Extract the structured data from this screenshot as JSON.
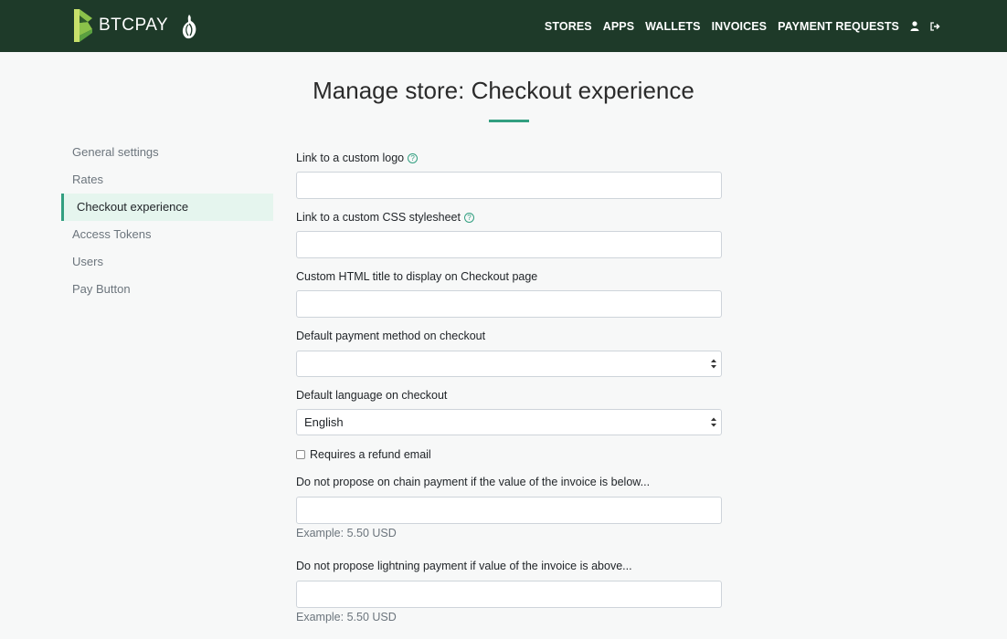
{
  "header": {
    "brand_text": "BTCPAY",
    "brand_colors": {
      "primary": "#8bc24a",
      "dark": "#2f5b2a",
      "bar": "#1e3a29"
    },
    "nav": [
      "STORES",
      "APPS",
      "WALLETS",
      "INVOICES",
      "PAYMENT REQUESTS"
    ],
    "icons": [
      "user-icon",
      "logout-icon"
    ]
  },
  "page": {
    "title": "Manage store: Checkout experience",
    "accent": "#329f80"
  },
  "sidebar": {
    "items": [
      {
        "label": "General settings",
        "active": false
      },
      {
        "label": "Rates",
        "active": false
      },
      {
        "label": "Checkout experience",
        "active": true
      },
      {
        "label": "Access Tokens",
        "active": false
      },
      {
        "label": "Users",
        "active": false
      },
      {
        "label": "Pay Button",
        "active": false
      }
    ]
  },
  "form": {
    "custom_logo_label": "Link to a custom logo",
    "custom_logo_value": "",
    "custom_css_label": "Link to a custom CSS stylesheet",
    "custom_css_value": "",
    "html_title_label": "Custom HTML title to display on Checkout page",
    "html_title_value": "",
    "default_payment_label": "Default payment method on checkout",
    "default_payment_value": "",
    "default_language_label": "Default language on checkout",
    "default_language_value": "English",
    "refund_email_label": "Requires a refund email",
    "refund_email_checked": false,
    "onchain_min_label": "Do not propose on chain payment if the value of the invoice is below...",
    "onchain_min_value": "",
    "onchain_min_hint": "Example: 5.50 USD",
    "lightning_max_label": "Do not propose lightning payment if value of the invoice is above...",
    "lightning_max_value": "",
    "lightning_max_hint": "Example: 5.50 USD"
  }
}
